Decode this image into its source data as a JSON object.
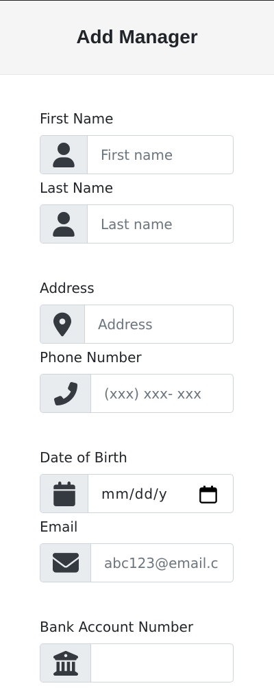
{
  "header": {
    "title": "Add Manager"
  },
  "fields": {
    "first_name": {
      "label": "First Name",
      "placeholder": "First name",
      "icon": "user-icon"
    },
    "last_name": {
      "label": "Last Name",
      "placeholder": "Last name",
      "icon": "user-icon"
    },
    "address": {
      "label": "Address",
      "placeholder": "Address",
      "icon": "map-marker-icon"
    },
    "phone": {
      "label": "Phone Number",
      "placeholder": "(xxx) xxx- xxx",
      "icon": "phone-icon"
    },
    "dob": {
      "label": "Date of Birth",
      "value_display": "mm/dd/y",
      "icon": "calendar-icon"
    },
    "email": {
      "label": "Email",
      "placeholder": "abc123@email.c",
      "icon": "envelope-icon"
    },
    "bank": {
      "label": "Bank Account Number",
      "placeholder": "",
      "icon": "bank-icon"
    }
  },
  "colors": {
    "addon_bg": "#e9ecef",
    "border": "#ced4da",
    "icon": "#343a40",
    "header_bg": "#f5f5f5"
  }
}
